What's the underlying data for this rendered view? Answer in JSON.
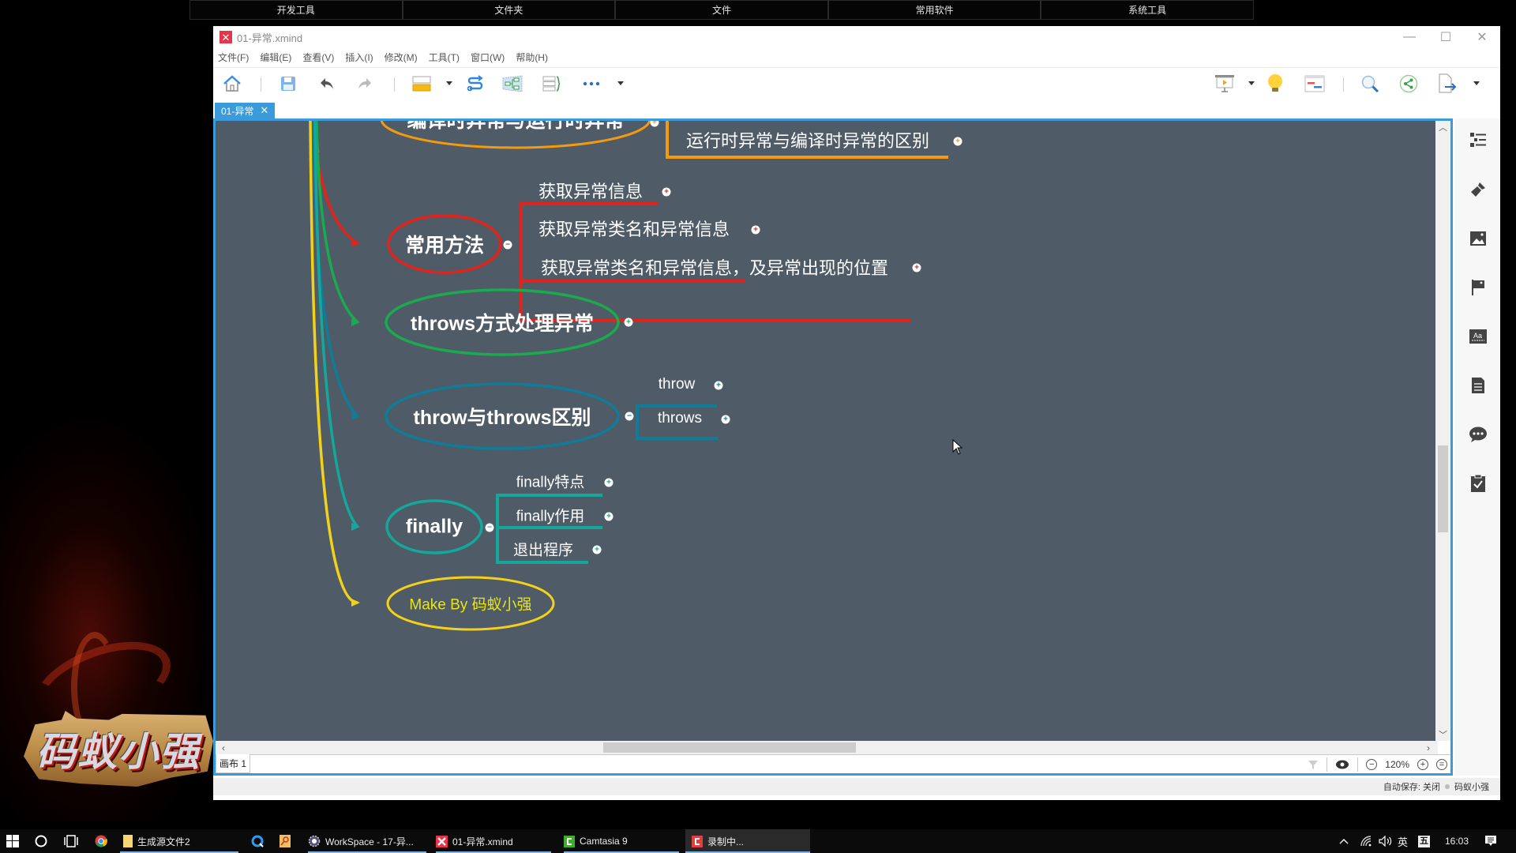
{
  "launcher": {
    "items": [
      "开发工具",
      "文件夹",
      "文件",
      "常用软件",
      "系统工具"
    ]
  },
  "desktop": {
    "logo_text": "码蚁小强"
  },
  "window": {
    "title": "01-异常.xmind",
    "controls": {
      "minimize": "—",
      "maximize": "☐",
      "close": "✕"
    }
  },
  "menu": [
    "文件(F)",
    "编辑(E)",
    "查看(V)",
    "插入(I)",
    "修改(M)",
    "工具(T)",
    "窗口(W)",
    "帮助(H)"
  ],
  "toolbar": {
    "left": [
      "home-icon",
      "save-icon",
      "undo-icon",
      "redo-icon",
      "topic-insert-icon",
      "relationship-icon",
      "structure-icon",
      "summary-boundary-icon",
      "more-icon"
    ],
    "right": [
      "presentation-icon",
      "brainstorm-bulb-icon",
      "gantt-icon",
      "search-icon",
      "share-icon",
      "export-icon"
    ]
  },
  "doc_tab": {
    "label": "01-异常",
    "close": "✕"
  },
  "mindmap": {
    "partial_top_node": "编译时异常与运行时异常",
    "partial_top_child": "运行时异常与编译时异常的区别",
    "branches": [
      {
        "id": "common-methods",
        "label": "常用方法",
        "color": "#e0241c",
        "children": [
          "获取异常信息",
          "获取异常类名和异常信息",
          "获取异常类名和异常信息，及异常出现的位置"
        ]
      },
      {
        "id": "throws-handling",
        "label": "throws方式处理异常",
        "color": "#1aab4f",
        "children": []
      },
      {
        "id": "throw-vs-throws",
        "label": "throw与throws区别",
        "color": "#0f7d99",
        "children": [
          "throw",
          "throws"
        ]
      },
      {
        "id": "finally",
        "label": "finally",
        "color": "#13a89a",
        "children": [
          "finally特点",
          "finally作用",
          "退出程序"
        ]
      },
      {
        "id": "author",
        "label": "Make By 码蚁小强",
        "color": "#f2d11b",
        "children": []
      }
    ],
    "top_branch_color": "#f29a10",
    "canvas_color": "#4f5b66"
  },
  "sheet": {
    "tab_label": "画布 1"
  },
  "zoom": {
    "level": "120%"
  },
  "status": {
    "autosave": "自动保存: 关闭",
    "user": "码蚁小强"
  },
  "right_panel": [
    "outline-icon",
    "format-brush-icon",
    "image-icon",
    "marker-flag-icon",
    "text-style-icon",
    "notes-icon",
    "comments-icon",
    "task-clipboard-icon"
  ],
  "taskbar": {
    "items": [
      {
        "label": "生成源文件2"
      },
      {
        "label": "WorkSpace - 17-异..."
      },
      {
        "label": "01-异常.xmind"
      },
      {
        "label": "Camtasia 9"
      },
      {
        "label": "录制中..."
      }
    ],
    "tray": {
      "ime": "英",
      "ime2": "五",
      "time": "16:03"
    }
  }
}
